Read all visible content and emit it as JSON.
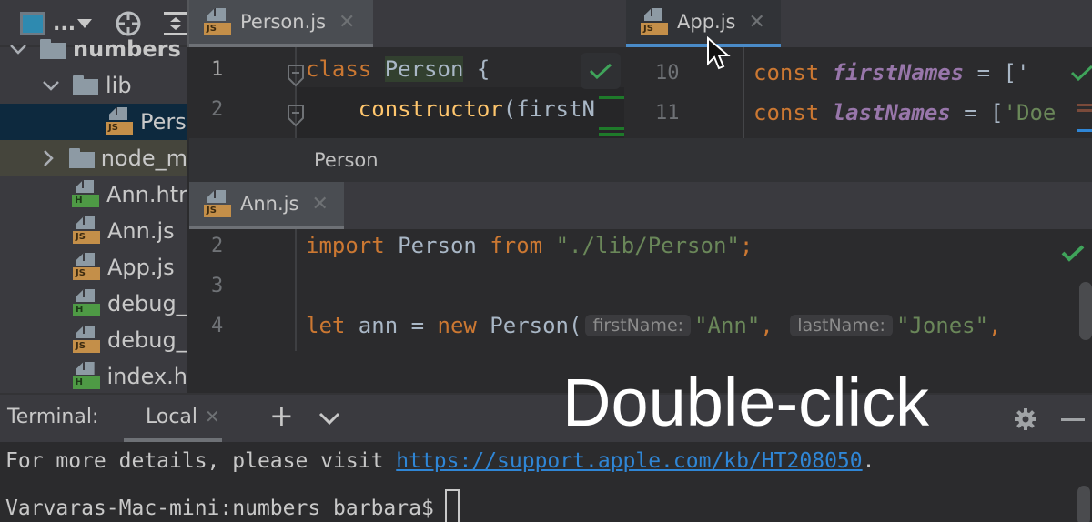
{
  "sidebar": {
    "toolbar": {
      "view_mode_label": "...",
      "icons": [
        "project-view-icon",
        "dropdown-icon",
        "locate-file-icon",
        "expand-collapse-icon"
      ]
    },
    "tree": [
      {
        "label": "numbers",
        "type": "folder",
        "expanded": true,
        "level": 0
      },
      {
        "label": "lib",
        "type": "folder",
        "expanded": true,
        "level": 1
      },
      {
        "label": "Pers",
        "type": "js",
        "level": 2,
        "selected": true
      },
      {
        "label": "node_m",
        "type": "folder",
        "expanded": false,
        "level": 1,
        "excluded": true
      },
      {
        "label": "Ann.htr",
        "type": "html",
        "level": 1
      },
      {
        "label": "Ann.js",
        "type": "js",
        "level": 1
      },
      {
        "label": "App.js",
        "type": "js",
        "level": 1
      },
      {
        "label": "debug_",
        "type": "html",
        "level": 1
      },
      {
        "label": "debug_",
        "type": "js",
        "level": 1
      },
      {
        "label": "index.h",
        "type": "html",
        "level": 1
      }
    ]
  },
  "top_editor": {
    "left_pane": {
      "tab": {
        "label": "Person.js",
        "badge": "JS"
      },
      "lines": [
        {
          "num": "1",
          "tokens": [
            [
              "kw",
              "class "
            ],
            [
              "cls-hl",
              "Person"
            ],
            [
              "punc",
              " {"
            ]
          ]
        },
        {
          "num": "2",
          "tokens": [
            [
              "punc",
              "    "
            ],
            [
              "fn",
              "constructor"
            ],
            [
              "punc",
              "(firstN"
            ]
          ]
        }
      ],
      "breadcrumb": "Person"
    },
    "right_pane": {
      "tab": {
        "label": "App.js",
        "badge": "JS"
      },
      "lines": [
        {
          "num": "10",
          "tokens": [
            [
              "kw",
              "const "
            ],
            [
              "var",
              "firstNames"
            ],
            [
              "punc",
              " = ['"
            ]
          ]
        },
        {
          "num": "11",
          "tokens": [
            [
              "kw",
              "const "
            ],
            [
              "var",
              "lastNames"
            ],
            [
              "punc",
              " = ["
            ],
            [
              "str",
              "'Doe"
            ]
          ]
        }
      ]
    }
  },
  "bottom_editor": {
    "tab": {
      "label": "Ann.js",
      "badge": "JS"
    },
    "lines": [
      {
        "num": "2",
        "tokens": [
          [
            "kw",
            "import "
          ],
          [
            "cls",
            "Person "
          ],
          [
            "kw",
            "from "
          ],
          [
            "str",
            "\"./lib/Person\""
          ],
          [
            "kw",
            ";"
          ]
        ]
      },
      {
        "num": "3",
        "tokens": []
      },
      {
        "num": "4",
        "tokens": [
          [
            "kw",
            "let "
          ],
          [
            "cls",
            "ann = "
          ],
          [
            "kw",
            "new "
          ],
          [
            "cls",
            "Person("
          ],
          [
            "hint",
            "firstName:"
          ],
          [
            "str",
            "\"Ann\""
          ],
          [
            "kw",
            ", "
          ],
          [
            "hint",
            "lastName:"
          ],
          [
            "str",
            "\"Jones\""
          ],
          [
            "kw",
            ","
          ]
        ]
      }
    ]
  },
  "terminal": {
    "title": "Terminal:",
    "tab_label": "Local",
    "add_label": "+",
    "output": [
      {
        "text": "For more details, please visit ",
        "link": "https://support.apple.com/kb/HT208050",
        "suffix": "."
      },
      {
        "text": "Varvaras-Mac-mini:numbers barbara$ "
      }
    ]
  },
  "overlay_caption": "Double-click",
  "colors": {
    "keyword": "#cc7832",
    "identifier": "#a9b7c6",
    "function": "#ffc66d",
    "constant": "#9876aa",
    "string": "#6a8759",
    "link": "#2f86d6",
    "active_tab_underline": "#4a8bc8",
    "selected_tree_row": "#0d293e",
    "inspection_ok": "#3fa35a"
  }
}
